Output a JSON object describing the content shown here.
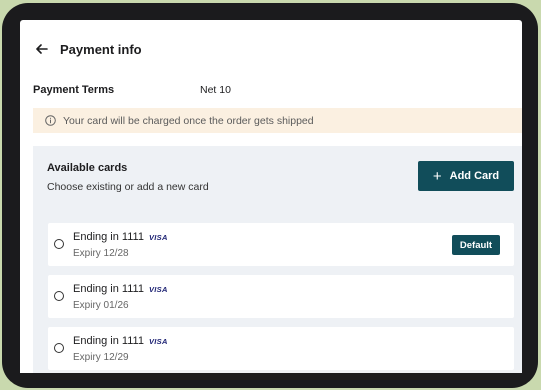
{
  "header": {
    "back_icon": "arrow-left-icon",
    "title": "Payment info"
  },
  "payment_terms": {
    "label": "Payment Terms",
    "value": "Net 10"
  },
  "notice": {
    "icon": "info-icon",
    "text": "Your card will be charged once the order gets shipped"
  },
  "cards": {
    "title": "Available cards",
    "subtitle": "Choose existing or add a new card",
    "add_button_label": "Add Card",
    "items": [
      {
        "name": "Ending in 1111",
        "brand": "VISA",
        "expiry": "Expiry 12/28",
        "badge": "Default"
      },
      {
        "name": "Ending in 1111",
        "brand": "VISA",
        "expiry": "Expiry 01/26"
      },
      {
        "name": "Ending in 1111",
        "brand": "VISA",
        "expiry": "Expiry 12/29"
      }
    ]
  },
  "colors": {
    "accent": "#114d5a",
    "notice_bg": "#fbf0e1",
    "panel_bg": "#eef1f5",
    "visa_blue": "#1a1f71",
    "backdrop": "#c9d9ae"
  }
}
